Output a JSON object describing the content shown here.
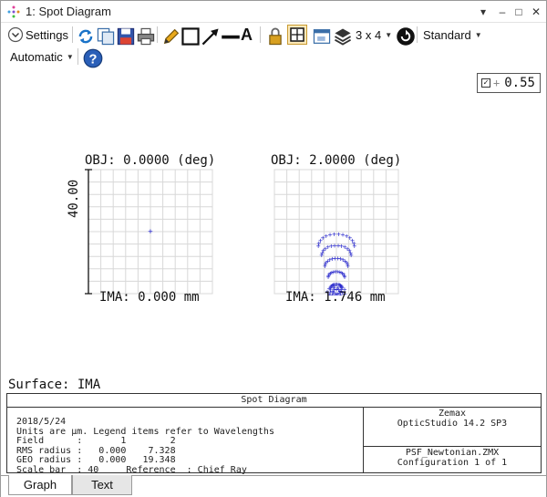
{
  "window": {
    "title": "1: Spot Diagram",
    "controls": {
      "menu": "▾",
      "minimize": "–",
      "maximize": "□",
      "close": "✕"
    }
  },
  "toolbar": {
    "settings_label": "Settings",
    "layout_label": "3 x 4",
    "standard_label": "Standard",
    "automatic_label": "Automatic",
    "text_tool": "A",
    "icons": [
      "refresh-icon",
      "copy-icon",
      "save-icon",
      "print-icon",
      "pencil-icon",
      "rectangle-icon",
      "arrow-icon",
      "line-icon",
      "text-icon",
      "lock-icon",
      "crosshair-icon",
      "window-icon",
      "layers-icon",
      "rotate-icon",
      "help-icon"
    ]
  },
  "legend": {
    "check": "✓",
    "plus": "+",
    "wavelength": "0.55"
  },
  "plots": [
    {
      "obj": "OBJ: 0.0000 (deg)",
      "ima": "IMA: 0.000 mm",
      "scale_label": "40.00"
    },
    {
      "obj": "OBJ: 2.0000 (deg)",
      "ima": "IMA: 1.746 mm"
    }
  ],
  "surface": "Surface: IMA",
  "info": {
    "header": "Spot Diagram",
    "date": "2018/5/24",
    "units_line": "Units are µm. Legend items refer to Wavelengths",
    "field_line": "Field      :       1        2",
    "rms_line": "RMS radius :   0.000    7.328",
    "geo_line": "GEO radius :   0.000   19.348",
    "scale_line": "Scale bar  : 40     Reference  : Chief Ray",
    "company": "Zemax",
    "product": "OpticStudio 14.2 SP3",
    "file": "PSF_Newtonian.ZMX",
    "config": "Configuration 1 of 1"
  },
  "tabs": [
    {
      "label": "Graph"
    },
    {
      "label": "Text"
    }
  ],
  "colors": {
    "spot": "#2a2acc",
    "grid": "#d8d8d8",
    "refresh": "#1a73c8"
  }
}
